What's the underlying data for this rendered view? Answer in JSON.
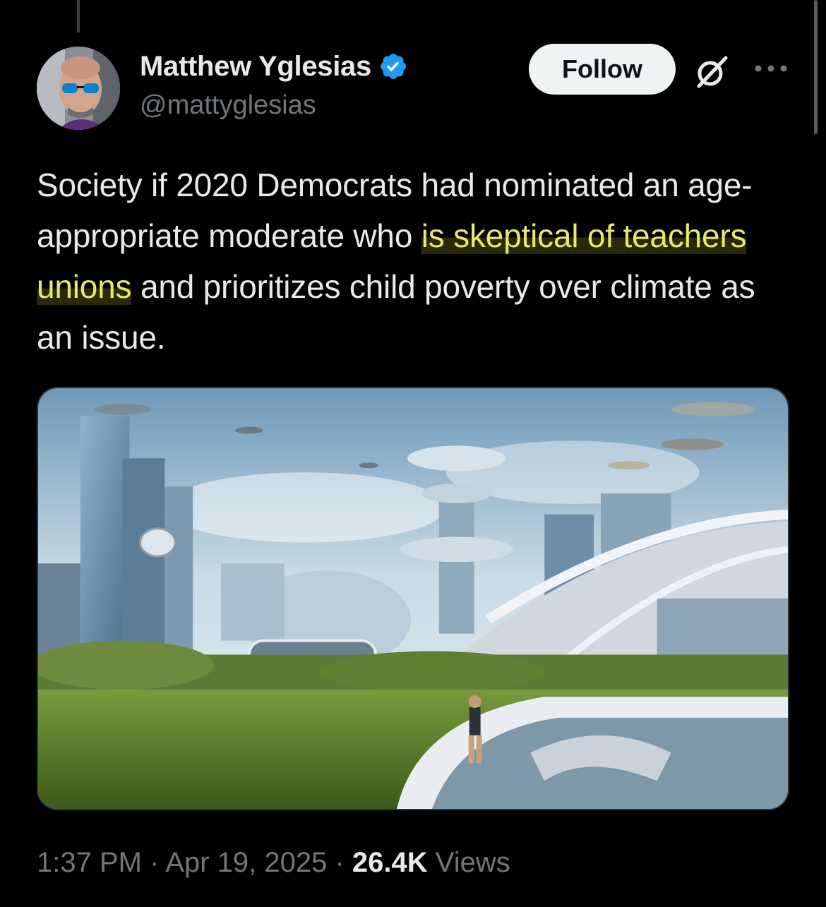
{
  "author": {
    "display_name": "Matthew Yglesias",
    "handle": "@mattyglesias",
    "verified": true
  },
  "actions": {
    "follow_label": "Follow",
    "icons": [
      "grok-icon",
      "more-icon"
    ]
  },
  "tweet": {
    "text_before": "Society if 2020 Democrats had nominated an age-appropriate moderate who ",
    "text_highlight": "is skeptical of teachers unions",
    "text_after": " and prioritizes child poverty over climate as an issue."
  },
  "meta": {
    "time": "1:37 PM",
    "separator": " · ",
    "date": "Apr 19, 2025",
    "views_count": "26.4K",
    "views_label": "Views"
  },
  "colors": {
    "background": "#000000",
    "text": "#e7e9ea",
    "muted": "#71767b",
    "verified_blue": "#1d9bf0",
    "highlight": "#e8e86a"
  }
}
